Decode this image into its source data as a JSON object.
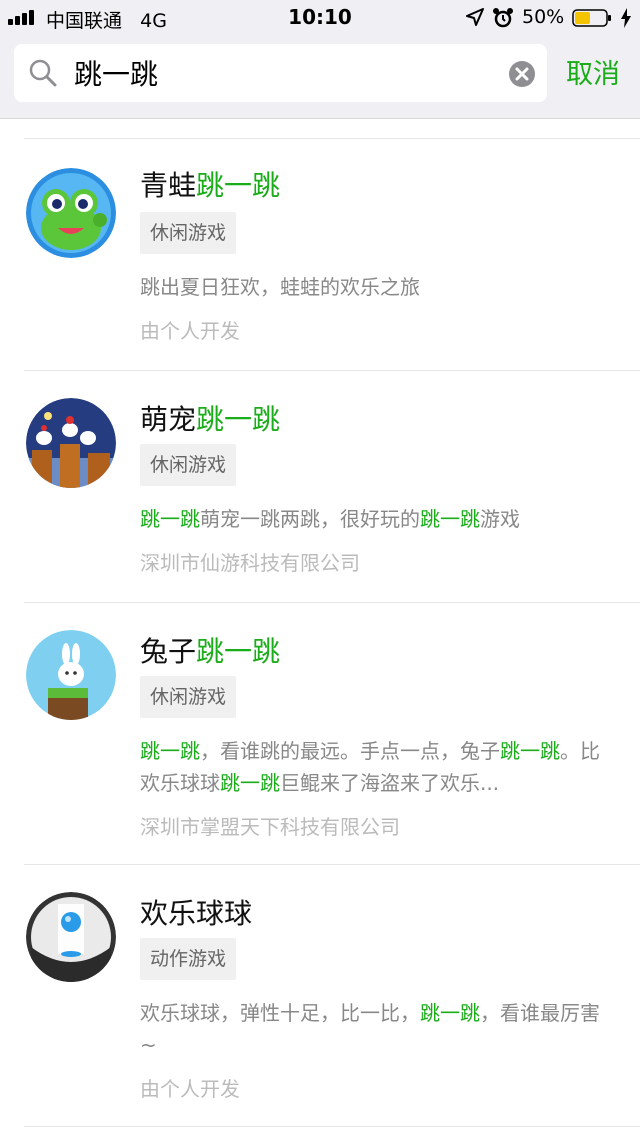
{
  "status_bar": {
    "carrier": "中国联通",
    "network": "4G",
    "time": "10:10",
    "battery": "50%"
  },
  "search": {
    "query": "跳一跳",
    "cancel_label": "取消"
  },
  "colors": {
    "accent": "#1aad19",
    "battery_fill": "#f5c400"
  },
  "results": [
    {
      "title_prefix": "青蛙",
      "title_highlight": "跳一跳",
      "title_suffix": "",
      "tag": "休闲游戏",
      "desc": [
        {
          "t": "跳出夏日狂欢，蛙蛙的欢乐之旅",
          "h": false
        }
      ],
      "developer": "由个人开发",
      "icon": "frog-icon"
    },
    {
      "title_prefix": "萌宠",
      "title_highlight": "跳一跳",
      "title_suffix": "",
      "tag": "休闲游戏",
      "desc": [
        {
          "t": "跳一跳",
          "h": true
        },
        {
          "t": "萌宠一跳两跳，很好玩的",
          "h": false
        },
        {
          "t": "跳一跳",
          "h": true
        },
        {
          "t": "游戏",
          "h": false
        }
      ],
      "developer": "深圳市仙游科技有限公司",
      "icon": "pets-icon"
    },
    {
      "title_prefix": "兔子",
      "title_highlight": "跳一跳",
      "title_suffix": "",
      "tag": "休闲游戏",
      "desc": [
        {
          "t": "跳一跳",
          "h": true
        },
        {
          "t": "，看谁跳的最远。手点一点，兔子",
          "h": false
        },
        {
          "t": "跳一跳",
          "h": true
        },
        {
          "t": "。比欢乐球球",
          "h": false
        },
        {
          "t": "跳一跳",
          "h": true
        },
        {
          "t": "巨鲲来了海盗来了欢乐...",
          "h": false
        }
      ],
      "developer": "深圳市掌盟天下科技有限公司",
      "icon": "rabbit-icon"
    },
    {
      "title_prefix": "欢乐球球",
      "title_highlight": "",
      "title_suffix": "",
      "tag": "动作游戏",
      "desc": [
        {
          "t": "欢乐球球，弹性十足，比一比，",
          "h": false
        },
        {
          "t": "跳一跳",
          "h": true
        },
        {
          "t": "，看谁最厉害~",
          "h": false
        }
      ],
      "developer": "由个人开发",
      "icon": "ball-icon"
    }
  ]
}
